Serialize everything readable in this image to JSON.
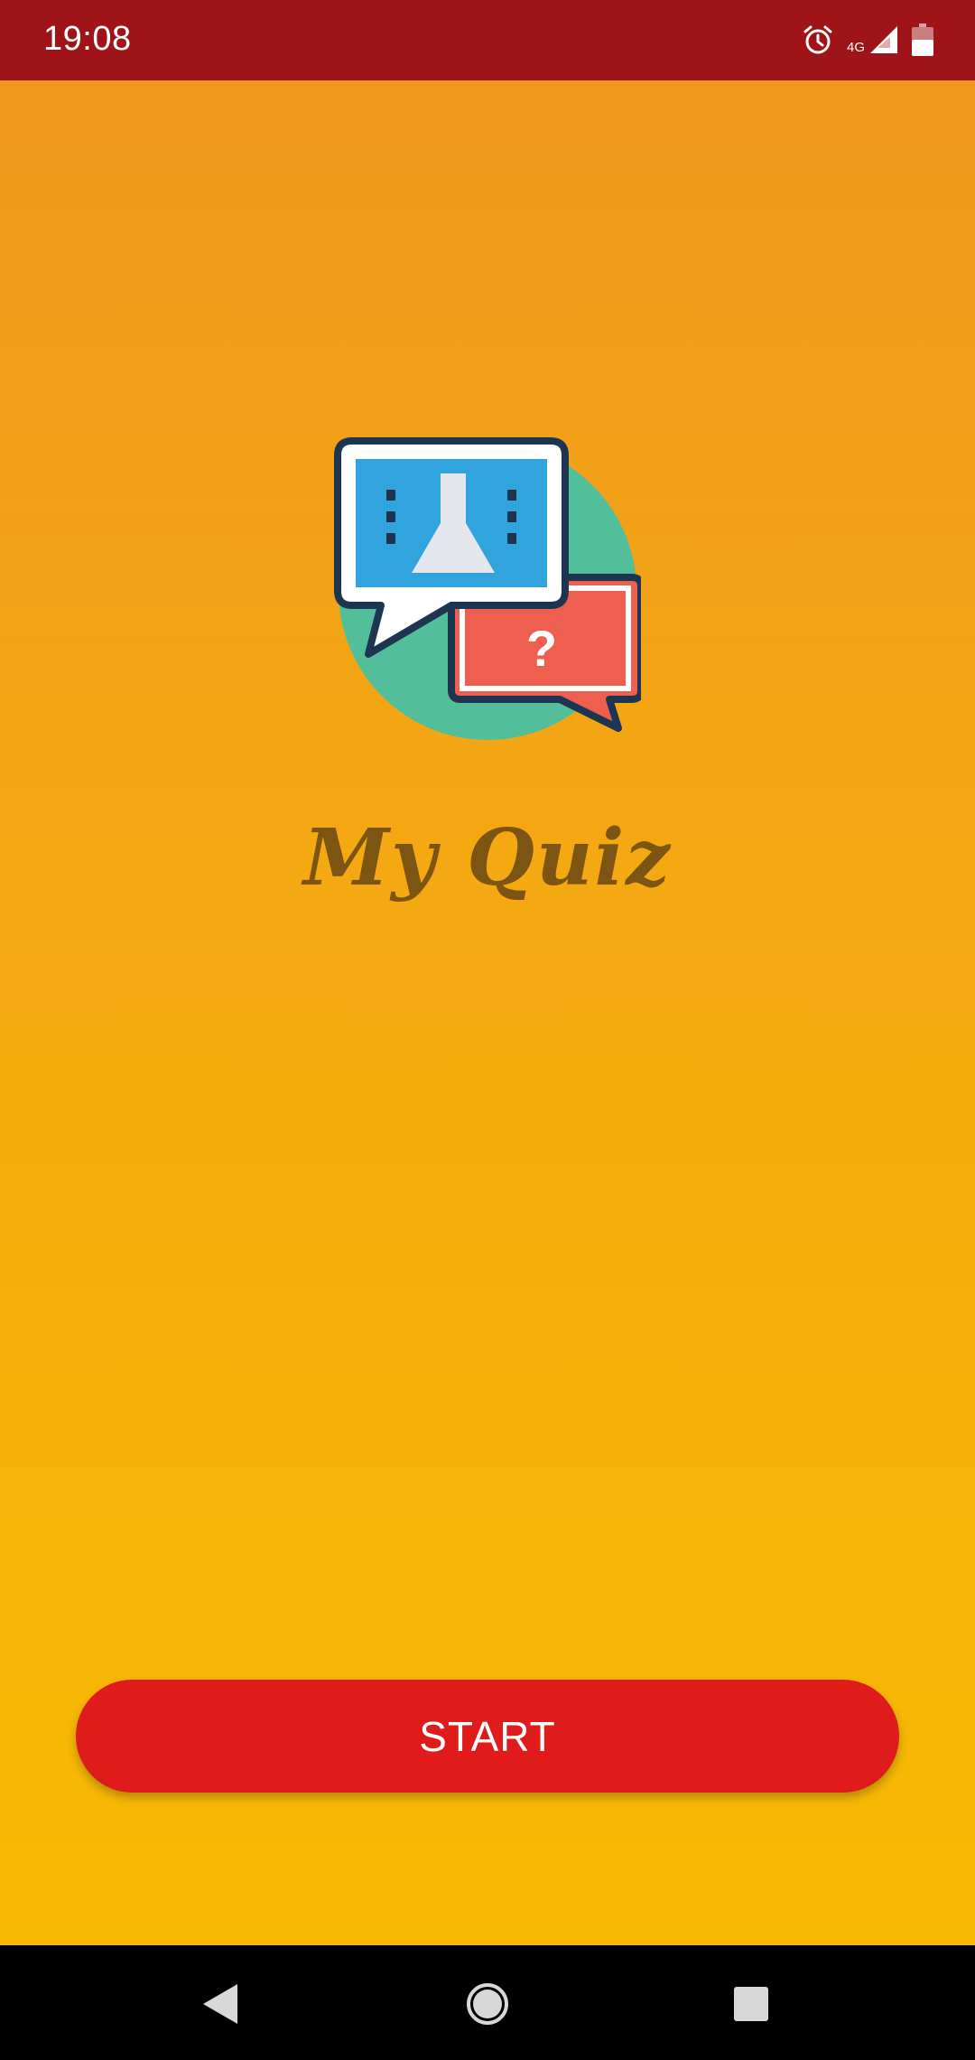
{
  "status_bar": {
    "time": "19:08",
    "network_label": "4G",
    "icons": [
      "alarm-icon",
      "signal-icon",
      "battery-icon"
    ]
  },
  "app": {
    "title": "My Quiz",
    "logo": "quiz-chat-bubbles-logo",
    "start_button_label": "START"
  },
  "colors": {
    "status_bar": "#9e1418",
    "gradient_top": "#f0981e",
    "gradient_bottom": "#f8bb04",
    "title": "#7b5511",
    "button": "#df1b1b",
    "logo_circle": "#52bf9a",
    "logo_blue": "#31a3dd",
    "logo_red": "#ef5f50",
    "logo_outline": "#1d3550"
  },
  "nav_bar": {
    "buttons": [
      "back-icon",
      "home-icon",
      "recents-icon"
    ]
  }
}
